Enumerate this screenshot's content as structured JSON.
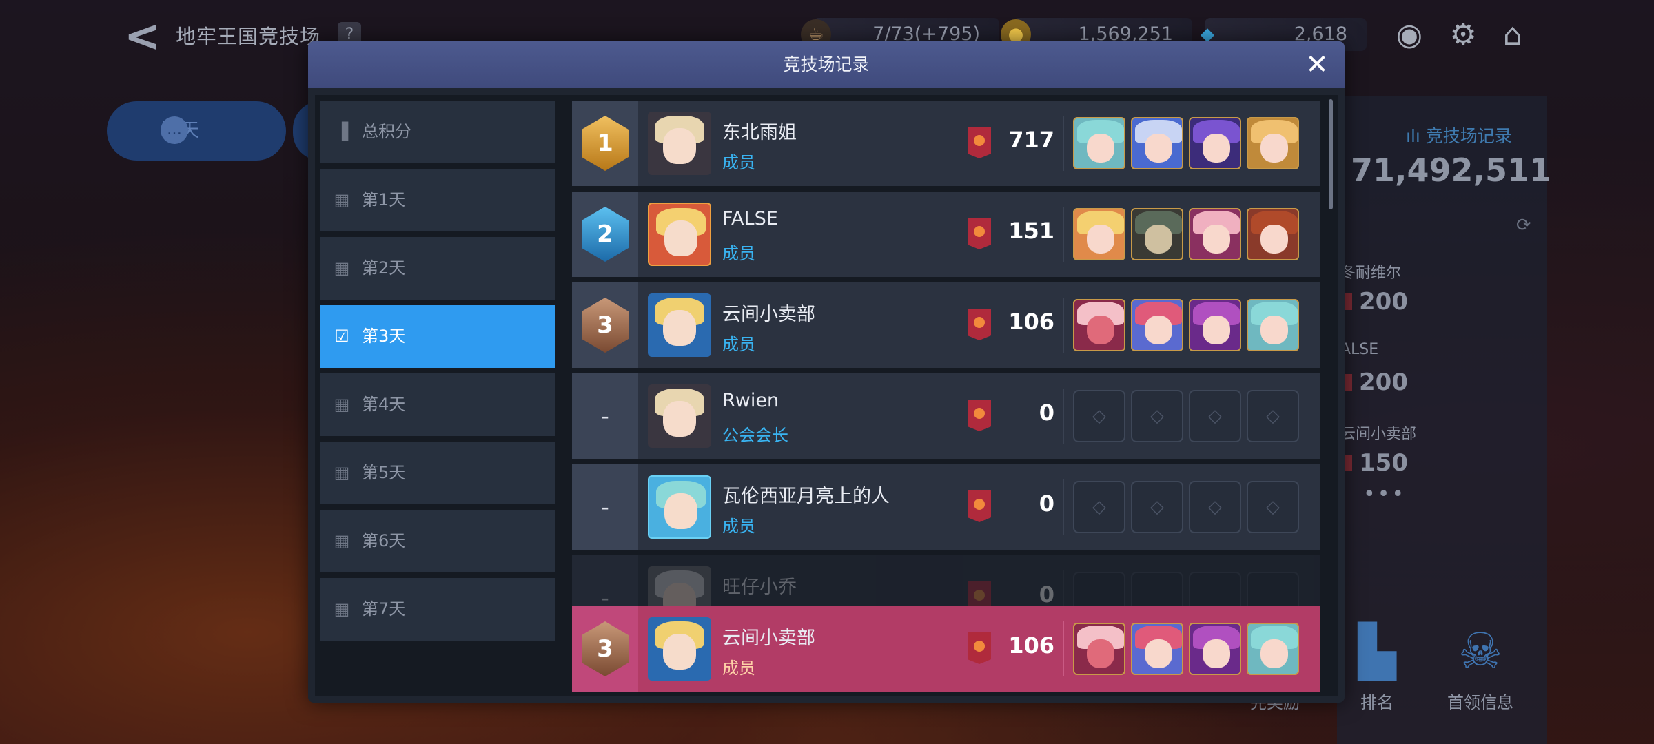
{
  "topbar": {
    "title": "地牢王国竞技场",
    "help": "?",
    "stamina": "7/73(+795)",
    "gold": "1,569,251",
    "gems": "2,618"
  },
  "chat": {
    "label": "聊天"
  },
  "right_panel": {
    "link": "竞技场记录",
    "score": "71,492,511",
    "entries": [
      {
        "name": "冬耐维尔",
        "value": "200"
      },
      {
        "name": "ALSE",
        "value": "200"
      },
      {
        "name": "云间小卖部",
        "value": "150"
      }
    ],
    "more": "•••"
  },
  "bottom_nav": [
    {
      "label": "完奖励",
      "icon": "reward-icon"
    },
    {
      "label": "排名",
      "icon": "ranking-icon"
    },
    {
      "label": "首领信息",
      "icon": "boss-icon"
    }
  ],
  "modal": {
    "title": "竞技场记录",
    "close": "✕"
  },
  "sidebar": [
    {
      "label": "总积分",
      "icon": "bar-chart-icon",
      "active": false
    },
    {
      "label": "第1天",
      "icon": "calendar-icon",
      "active": false
    },
    {
      "label": "第2天",
      "icon": "calendar-icon",
      "active": false
    },
    {
      "label": "第3天",
      "icon": "calendar-check-icon",
      "active": true
    },
    {
      "label": "第4天",
      "icon": "calendar-icon",
      "active": false
    },
    {
      "label": "第5天",
      "icon": "calendar-icon",
      "active": false
    },
    {
      "label": "第6天",
      "icon": "calendar-icon",
      "active": false
    },
    {
      "label": "第7天",
      "icon": "calendar-icon",
      "active": false
    }
  ],
  "rows": [
    {
      "rank": "1",
      "medal": "gold",
      "name": "东北雨姐",
      "role": "成员",
      "score": "717",
      "team": true
    },
    {
      "rank": "2",
      "medal": "blue",
      "name": "FALSE",
      "role": "成员",
      "score": "151",
      "team": true
    },
    {
      "rank": "3",
      "medal": "bronze",
      "name": "云间小卖部",
      "role": "成员",
      "score": "106",
      "team": true
    },
    {
      "rank": "-",
      "medal": "none",
      "name": "Rwien",
      "role": "公会会长",
      "score": "0",
      "team": false
    },
    {
      "rank": "-",
      "medal": "none",
      "name": "瓦伦西亚月亮上的人",
      "role": "成员",
      "score": "0",
      "team": false
    },
    {
      "rank": "-",
      "medal": "none",
      "name": "旺仔小乔",
      "role": "",
      "score": "0",
      "team": false
    }
  ],
  "my_row": {
    "rank": "3",
    "medal": "bronze",
    "name": "云间小卖部",
    "role": "成员",
    "score": "106"
  },
  "colors": {
    "accent": "#2f9bf0",
    "my_row": "#b23c66",
    "role_text": "#39b4f2",
    "header": "#4d5a8f"
  }
}
